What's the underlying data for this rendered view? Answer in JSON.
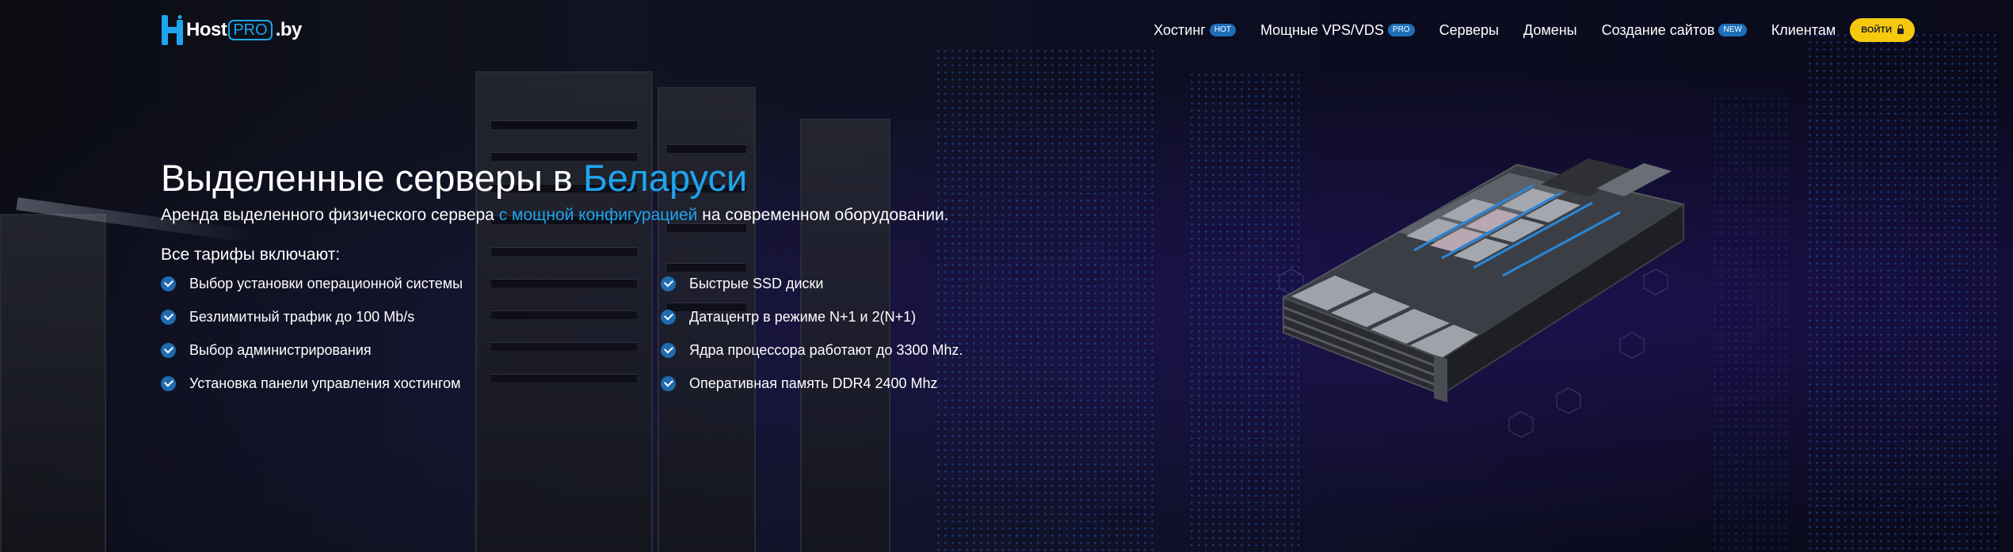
{
  "brand": {
    "name_part1": "Host",
    "name_part2": "PRO",
    "name_part3": ".by"
  },
  "nav": {
    "items": [
      {
        "label": "Хостинг",
        "badge": "HOT"
      },
      {
        "label": "Мощные VPS/VDS",
        "badge": "PRO"
      },
      {
        "label": "Серверы",
        "badge": ""
      },
      {
        "label": "Домены",
        "badge": ""
      },
      {
        "label": "Создание сайтов",
        "badge": "NEW"
      },
      {
        "label": "Клиентам",
        "badge": ""
      }
    ],
    "login_label": "ВОЙТИ"
  },
  "hero": {
    "title_main": "Выделенные серверы в ",
    "title_highlight": "Беларуси",
    "subtitle_before": "Аренда выделенного физического сервера ",
    "subtitle_link": "с мощной конфигурацией",
    "subtitle_after": " на современном оборудовании.",
    "tariffs_title": "Все тарифы включают:",
    "features_left": [
      "Выбор установки операционной системы",
      "Безлимитный трафик до 100 Mb/s",
      "Выбор администрирования",
      "Установка панели управления хостингом"
    ],
    "features_right": [
      "Быстрые SSD диски",
      "Датацентр в режиме N+1 и 2(N+1)",
      "Ядра процессора работают до 3300 Mhz.",
      "Оперативная память DDR4 2400 Mhz"
    ]
  },
  "colors": {
    "accent": "#1ea5ee",
    "badge": "#1e6fb8",
    "login": "#f6c90e",
    "check": "#1f6bb0"
  }
}
